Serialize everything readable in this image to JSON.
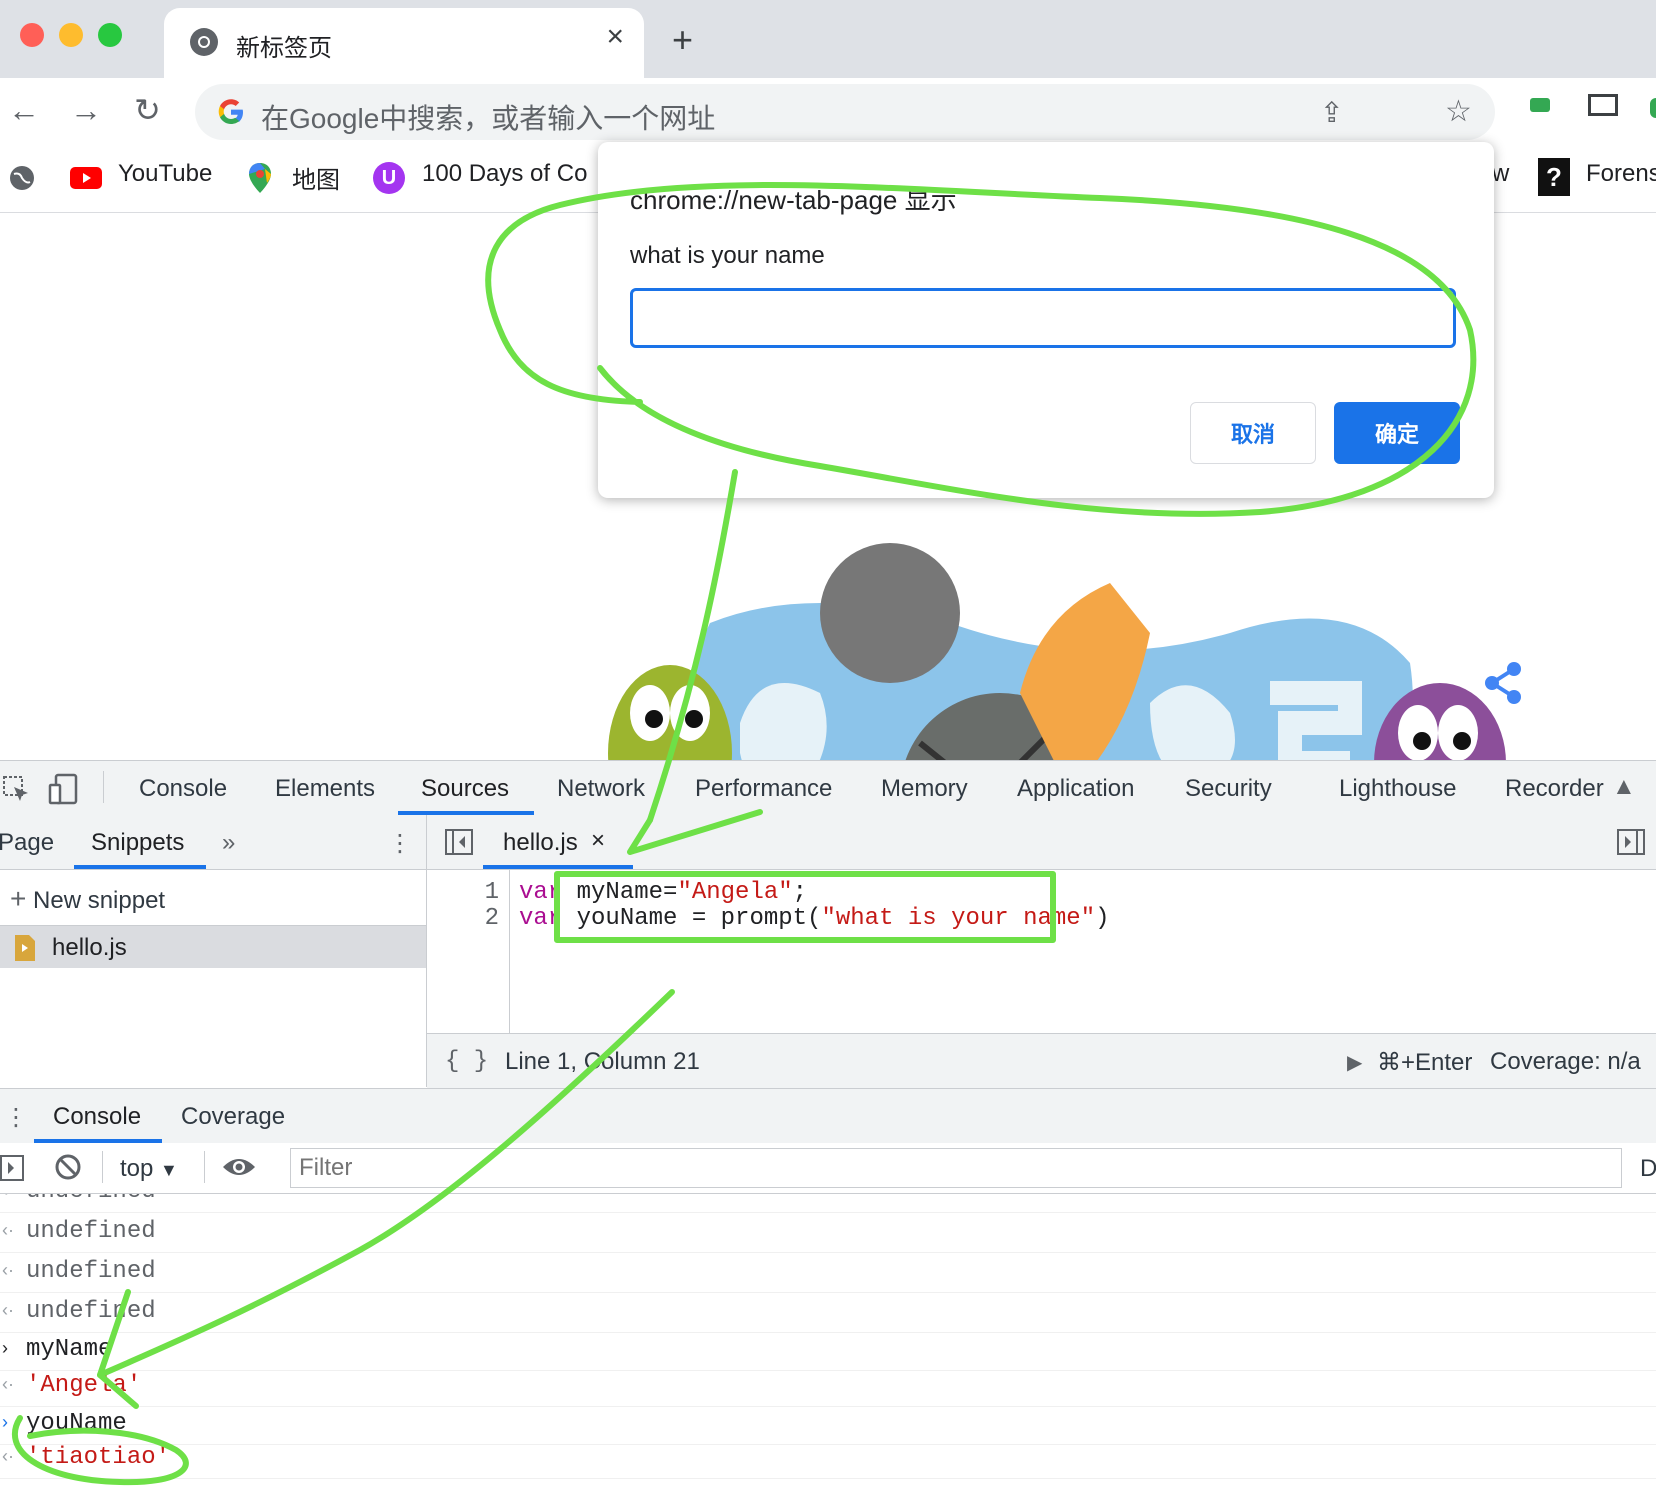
{
  "browser": {
    "tab_title": "新标签页",
    "tab_close": "×",
    "new_tab": "+",
    "omnibox_placeholder": "在Google中搜索，或者输入一个网址",
    "bookmarks": [
      {
        "label": "YouTube"
      },
      {
        "label": "地图"
      },
      {
        "label": "100 Days of Co"
      },
      {
        "label": "w"
      },
      {
        "label": "Forens"
      }
    ]
  },
  "dialog": {
    "title": "chrome://new-tab-page 显示",
    "message": "what is your name",
    "input_value": "",
    "cancel_label": "取消",
    "ok_label": "确定"
  },
  "devtools": {
    "tabs": [
      "Console",
      "Elements",
      "Sources",
      "Network",
      "Performance",
      "Memory",
      "Application",
      "Security",
      "Lighthouse",
      "Recorder"
    ],
    "active_tab": "Sources",
    "navigator_tabs": [
      "Page",
      "Snippets"
    ],
    "new_snippet": "New snippet",
    "snippet_file": "hello.js",
    "editor_tab": "hello.js",
    "editor_tab_close": "×",
    "code_lines": [
      {
        "num": "1",
        "kw": "var",
        "pre": " myName=",
        "str": "\"Angela\"",
        "post": ";"
      },
      {
        "num": "2",
        "kw": "var",
        "pre": " youName = prompt(",
        "str": "\"what is your name\"",
        "post": ")"
      }
    ],
    "status_brace": "{ }",
    "status_position": "Line 1, Column 21",
    "status_run": "⌘+Enter",
    "status_coverage": "Coverage: n/a",
    "drawer_tabs": [
      "Console",
      "Coverage"
    ],
    "context": "top",
    "filter_placeholder": "Filter",
    "filter_extra": "D",
    "console_lines": [
      {
        "text": "undefined",
        "kind": "result"
      },
      {
        "text": "undefined",
        "kind": "result"
      },
      {
        "text": "undefined",
        "kind": "result"
      },
      {
        "text": "myName",
        "kind": "input"
      },
      {
        "text": "'Angela'",
        "kind": "string"
      },
      {
        "text": "youName",
        "kind": "input"
      },
      {
        "text": "'tiaotiao'",
        "kind": "string"
      }
    ]
  },
  "colors": {
    "accent": "#1a73e8",
    "annotation": "#6ee047",
    "string": "#c41a16",
    "keyword": "#aa0d91"
  }
}
